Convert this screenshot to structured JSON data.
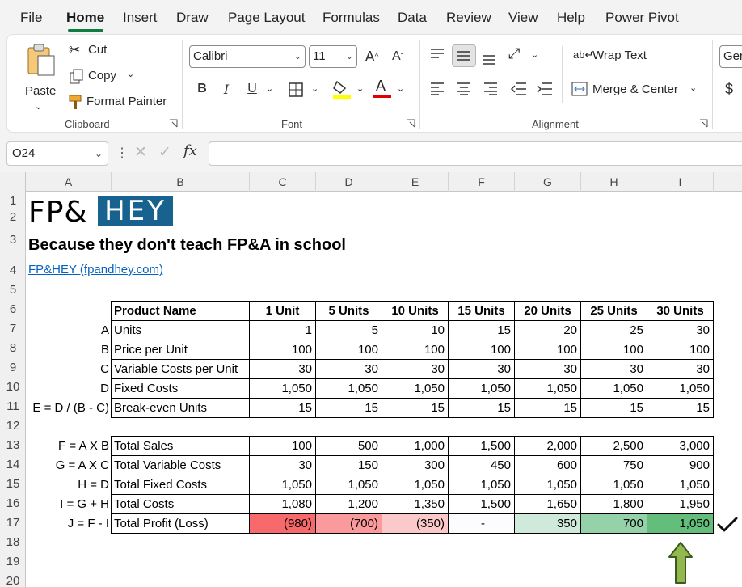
{
  "menu": {
    "tabs": [
      "File",
      "Home",
      "Insert",
      "Draw",
      "Page Layout",
      "Formulas",
      "Data",
      "Review",
      "View",
      "Help",
      "Power Pivot"
    ],
    "active": "Home"
  },
  "ribbon": {
    "clipboard": {
      "paste": "Paste",
      "cut": "Cut",
      "copy": "Copy",
      "format_painter": "Format Painter",
      "group": "Clipboard"
    },
    "font": {
      "family": "Calibri",
      "size": "11",
      "group": "Font",
      "bold": "B",
      "italic": "I",
      "underline": "U",
      "grow": "A",
      "shrink": "A",
      "color_letter": "A"
    },
    "alignment": {
      "wrap": "Wrap Text",
      "merge": "Merge & Center",
      "group": "Alignment"
    },
    "number": {
      "format": "Gen",
      "currency": "$"
    }
  },
  "formula_bar": {
    "name_box": "O24",
    "fx": "fx",
    "value": ""
  },
  "columns": [
    "A",
    "B",
    "C",
    "D",
    "E",
    "F",
    "G",
    "H",
    "I"
  ],
  "rows": [
    "1",
    "2",
    "3",
    "4",
    "5",
    "6",
    "7",
    "8",
    "9",
    "10",
    "11",
    "12",
    "13",
    "14",
    "15",
    "16",
    "17",
    "18",
    "19",
    "20"
  ],
  "sheet": {
    "logo": {
      "left": "FP&",
      "right": "HEY"
    },
    "tagline": "Because they don't teach FP&A in school",
    "link": "FP&HEY (fpandhey.com)",
    "table1": {
      "header": [
        "Product Name",
        "1 Unit",
        "5 Units",
        "10 Units",
        "15 Units",
        "20 Units",
        "25 Units",
        "30 Units"
      ],
      "rows": [
        {
          "key": "A",
          "label": "Units",
          "values": [
            "1",
            "5",
            "10",
            "15",
            "20",
            "25",
            "30"
          ]
        },
        {
          "key": "B",
          "label": "Price per Unit",
          "values": [
            "100",
            "100",
            "100",
            "100",
            "100",
            "100",
            "100"
          ]
        },
        {
          "key": "C",
          "label": "Variable Costs per Unit",
          "values": [
            "30",
            "30",
            "30",
            "30",
            "30",
            "30",
            "30"
          ]
        },
        {
          "key": "D",
          "label": "Fixed Costs",
          "values": [
            "1,050",
            "1,050",
            "1,050",
            "1,050",
            "1,050",
            "1,050",
            "1,050"
          ]
        },
        {
          "key": "E = D / (B - C)",
          "label": "Break-even Units",
          "values": [
            "15",
            "15",
            "15",
            "15",
            "15",
            "15",
            "15"
          ]
        }
      ]
    },
    "table2": {
      "rows": [
        {
          "key": "F = A X B",
          "label": "Total Sales",
          "values": [
            "100",
            "500",
            "1,000",
            "1,500",
            "2,000",
            "2,500",
            "3,000"
          ]
        },
        {
          "key": "G = A X C",
          "label": "Total Variable Costs",
          "values": [
            "30",
            "150",
            "300",
            "450",
            "600",
            "750",
            "900"
          ]
        },
        {
          "key": "H = D",
          "label": "Total Fixed Costs",
          "values": [
            "1,050",
            "1,050",
            "1,050",
            "1,050",
            "1,050",
            "1,050",
            "1,050"
          ]
        },
        {
          "key": "I = G + H",
          "label": "Total Costs",
          "values": [
            "1,080",
            "1,200",
            "1,350",
            "1,500",
            "1,650",
            "1,800",
            "1,950"
          ]
        },
        {
          "key": "J = F - I",
          "label": "Total Profit (Loss)",
          "values": [
            "(980)",
            "(700)",
            "(350)",
            "-",
            "350",
            "700",
            "1,050"
          ]
        }
      ],
      "profit_colors": [
        "#f8696b",
        "#fa9a9c",
        "#fcc9ca",
        "#fcfcff",
        "#cfeada",
        "#95d1a9",
        "#63be7b"
      ]
    }
  },
  "colors": {
    "accent": "#107c41",
    "logo_blue": "#17628f",
    "link": "#0563c1",
    "arrow_fill": "#93b84f",
    "arrow_stroke": "#3d5a1e"
  }
}
